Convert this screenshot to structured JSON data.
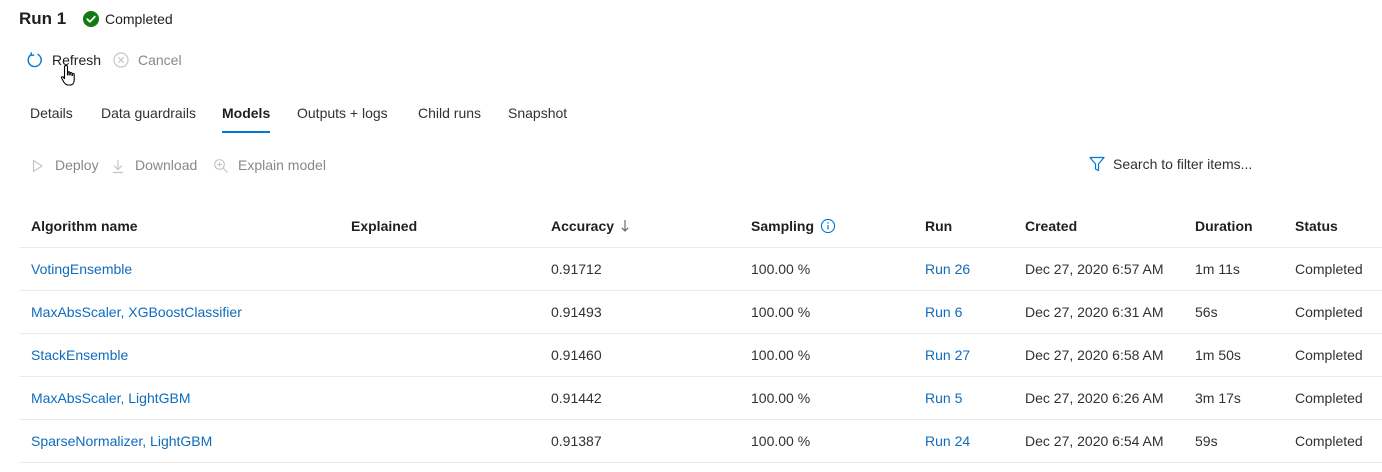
{
  "header": {
    "title": "Run 1",
    "status": "Completed"
  },
  "commands": {
    "refresh": "Refresh",
    "cancel": "Cancel"
  },
  "tabs": [
    {
      "label": "Details"
    },
    {
      "label": "Data guardrails"
    },
    {
      "label": "Models",
      "active": true
    },
    {
      "label": "Outputs + logs"
    },
    {
      "label": "Child runs"
    },
    {
      "label": "Snapshot"
    }
  ],
  "toolbar": {
    "deploy": "Deploy",
    "download": "Download",
    "explain": "Explain model",
    "filter_placeholder": "Search to filter items..."
  },
  "table": {
    "columns": [
      "Algorithm name",
      "Explained",
      "Accuracy",
      "Sampling",
      "Run",
      "Created",
      "Duration",
      "Status"
    ],
    "rows": [
      {
        "algorithm": "VotingEnsemble",
        "explained": "",
        "accuracy": "0.91712",
        "sampling": "100.00 %",
        "run": "Run 26",
        "created": "Dec 27, 2020 6:57 AM",
        "duration": "1m 11s",
        "status": "Completed"
      },
      {
        "algorithm": "MaxAbsScaler, XGBoostClassifier",
        "explained": "",
        "accuracy": "0.91493",
        "sampling": "100.00 %",
        "run": "Run 6",
        "created": "Dec 27, 2020 6:31 AM",
        "duration": "56s",
        "status": "Completed"
      },
      {
        "algorithm": "StackEnsemble",
        "explained": "",
        "accuracy": "0.91460",
        "sampling": "100.00 %",
        "run": "Run 27",
        "created": "Dec 27, 2020 6:58 AM",
        "duration": "1m 50s",
        "status": "Completed"
      },
      {
        "algorithm": "MaxAbsScaler, LightGBM",
        "explained": "",
        "accuracy": "0.91442",
        "sampling": "100.00 %",
        "run": "Run 5",
        "created": "Dec 27, 2020 6:26 AM",
        "duration": "3m 17s",
        "status": "Completed"
      },
      {
        "algorithm": "SparseNormalizer, LightGBM",
        "explained": "",
        "accuracy": "0.91387",
        "sampling": "100.00 %",
        "run": "Run 24",
        "created": "Dec 27, 2020 6:54 AM",
        "duration": "59s",
        "status": "Completed"
      }
    ]
  },
  "colors": {
    "accent": "#0078d4",
    "link": "#0f6cbd",
    "success": "#107c10",
    "muted": "#8a8886"
  },
  "icons": {
    "status": "check-circle-icon",
    "refresh": "refresh-icon",
    "cancel": "cancel-icon",
    "deploy": "play-icon",
    "download": "download-icon",
    "explain": "zoom-in-icon",
    "filter": "filter-icon",
    "sort": "arrow-down-icon",
    "info": "info-icon",
    "cursor": "hand-pointer-icon"
  }
}
